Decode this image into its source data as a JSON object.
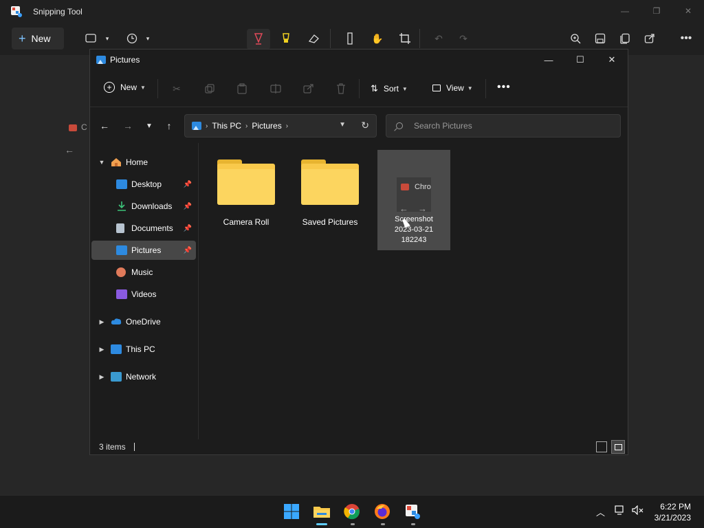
{
  "snipping_tool": {
    "title": "Snipping Tool",
    "new_label": "New",
    "win_minimize": "—",
    "win_restore": "❐",
    "win_close": "✕"
  },
  "canvas_background": {
    "tab_fragment": "C"
  },
  "explorer": {
    "title": "Pictures",
    "win_minimize": "—",
    "win_maximize": "☐",
    "win_close": "✕",
    "command_bar": {
      "new_label": "New",
      "sort_label": "Sort",
      "view_label": "View"
    },
    "address": {
      "segments": [
        "This PC",
        "Pictures"
      ]
    },
    "search": {
      "placeholder": "Search Pictures"
    },
    "sidebar": {
      "items": [
        {
          "label": "Home"
        },
        {
          "label": "Desktop"
        },
        {
          "label": "Downloads"
        },
        {
          "label": "Documents"
        },
        {
          "label": "Pictures"
        },
        {
          "label": "Music"
        },
        {
          "label": "Videos"
        },
        {
          "label": "OneDrive"
        },
        {
          "label": "This PC"
        },
        {
          "label": "Network"
        }
      ]
    },
    "files": [
      {
        "name": "Camera Roll",
        "type": "folder"
      },
      {
        "name": "Saved Pictures",
        "type": "folder"
      },
      {
        "name_lines": [
          "Screenshot",
          "2023-03-21",
          "182243"
        ],
        "type": "image",
        "thumb_text": "Chro"
      }
    ],
    "status": {
      "items_count": "3 items"
    }
  },
  "taskbar": {
    "clock_time": "6:22 PM",
    "clock_date": "3/21/2023"
  },
  "colors": {
    "accent": "#60cdff",
    "folder": "#f9c94b",
    "selected_bg": "#474747"
  }
}
